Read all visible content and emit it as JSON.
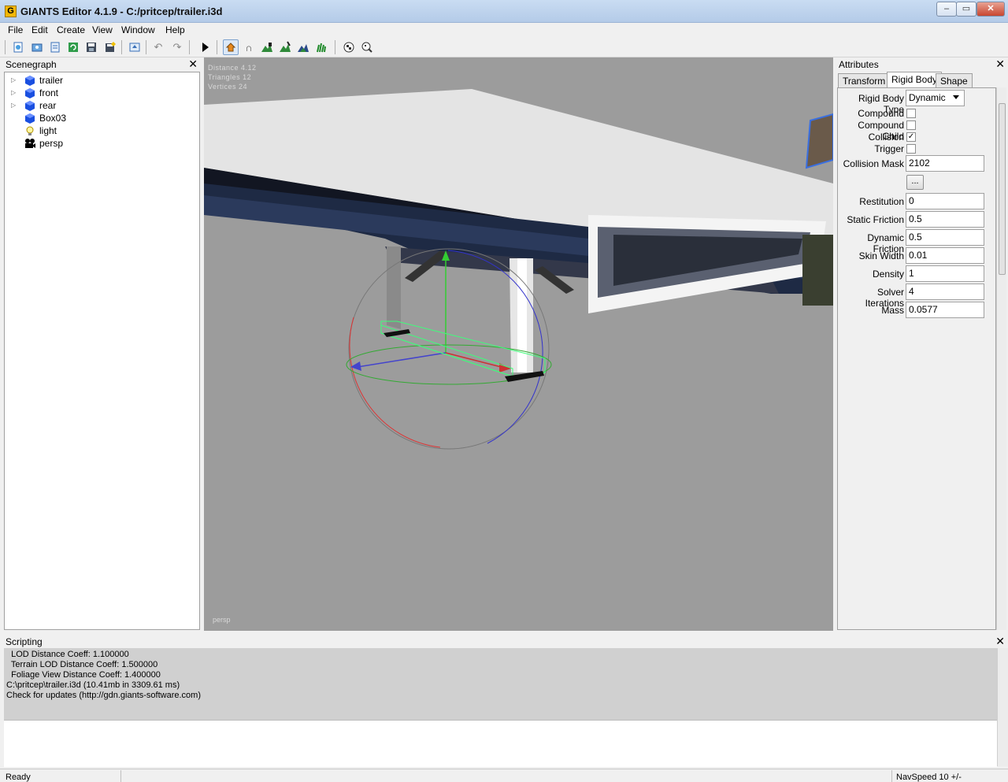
{
  "window": {
    "title": "GIANTS Editor 4.1.9 - C:/pritcep/trailer.i3d",
    "app_icon_letter": "G",
    "buttons": [
      "–",
      "▭",
      "✕"
    ]
  },
  "menu": [
    "File",
    "Edit",
    "Create",
    "View",
    "Window",
    "Help"
  ],
  "toolbar": {
    "icons": [
      "new-icon",
      "open-icon",
      "list-icon",
      "refresh-icon",
      "save-icon",
      "save-as-icon",
      "import-icon",
      "undo-icon",
      "redo-icon",
      "play-icon",
      "select-icon",
      "magnet-icon",
      "terrain-sculpt-icon",
      "terrain-paint-icon",
      "terrain-detail-icon",
      "foliage-paint-icon",
      "checker-icon",
      "checker-select-icon"
    ]
  },
  "scenegraph": {
    "title": "Scenegraph",
    "items": [
      {
        "label": "trailer",
        "icon": "cube-icon",
        "expandable": true
      },
      {
        "label": "front",
        "icon": "cube-icon",
        "expandable": true
      },
      {
        "label": "rear",
        "icon": "cube-icon",
        "expandable": true
      },
      {
        "label": "Box03",
        "icon": "cube-icon",
        "expandable": false
      },
      {
        "label": "light",
        "icon": "light-icon",
        "expandable": false
      },
      {
        "label": "persp",
        "icon": "camera-icon",
        "expandable": false
      }
    ]
  },
  "viewport": {
    "stats": [
      "Distance 4.12",
      "Triangles 12",
      "Vertices 24"
    ],
    "camera": "persp"
  },
  "attributes": {
    "title": "Attributes",
    "tabs": [
      "Transform",
      "Rigid Body",
      "Shape"
    ],
    "selected_tab": "Rigid Body",
    "rigid_body_type_label": "Rigid Body Type",
    "rigid_body_type_value": "Dynamic",
    "checkboxes": [
      {
        "label": "Compound",
        "checked": false
      },
      {
        "label": "Compound Child",
        "checked": false
      },
      {
        "label": "Collision",
        "checked": true
      },
      {
        "label": "Trigger",
        "checked": false
      }
    ],
    "collision_mask_label": "Collision Mask",
    "collision_mask_value": "2102",
    "more_button": "...",
    "fields": [
      {
        "label": "Restitution",
        "value": "0"
      },
      {
        "label": "Static Friction",
        "value": "0.5"
      },
      {
        "label": "Dynamic Friction",
        "value": "0.5"
      },
      {
        "label": "Skin Width",
        "value": "0.01"
      },
      {
        "label": "Density",
        "value": "1"
      },
      {
        "label": "Solver Iterations",
        "value": "4"
      },
      {
        "label": "Mass",
        "value": "0.0577"
      }
    ]
  },
  "scripting": {
    "title": "Scripting",
    "log": [
      "  LOD Distance Coeff: 1.100000",
      "  Terrain LOD Distance Coeff: 1.500000",
      "  Foliage View Distance Coeff: 1.400000",
      "C:\\pritcep\\trailer.i3d (10.41mb in 3309.61 ms)",
      "Check for updates (http://gdn.giants-software.com)"
    ]
  },
  "status": {
    "left": "Ready",
    "right": "NavSpeed 10 +/-"
  },
  "colors": {
    "trailer_body": "#1e2a44",
    "selection": "#3cff7a",
    "ground": "#9c9c9c"
  }
}
